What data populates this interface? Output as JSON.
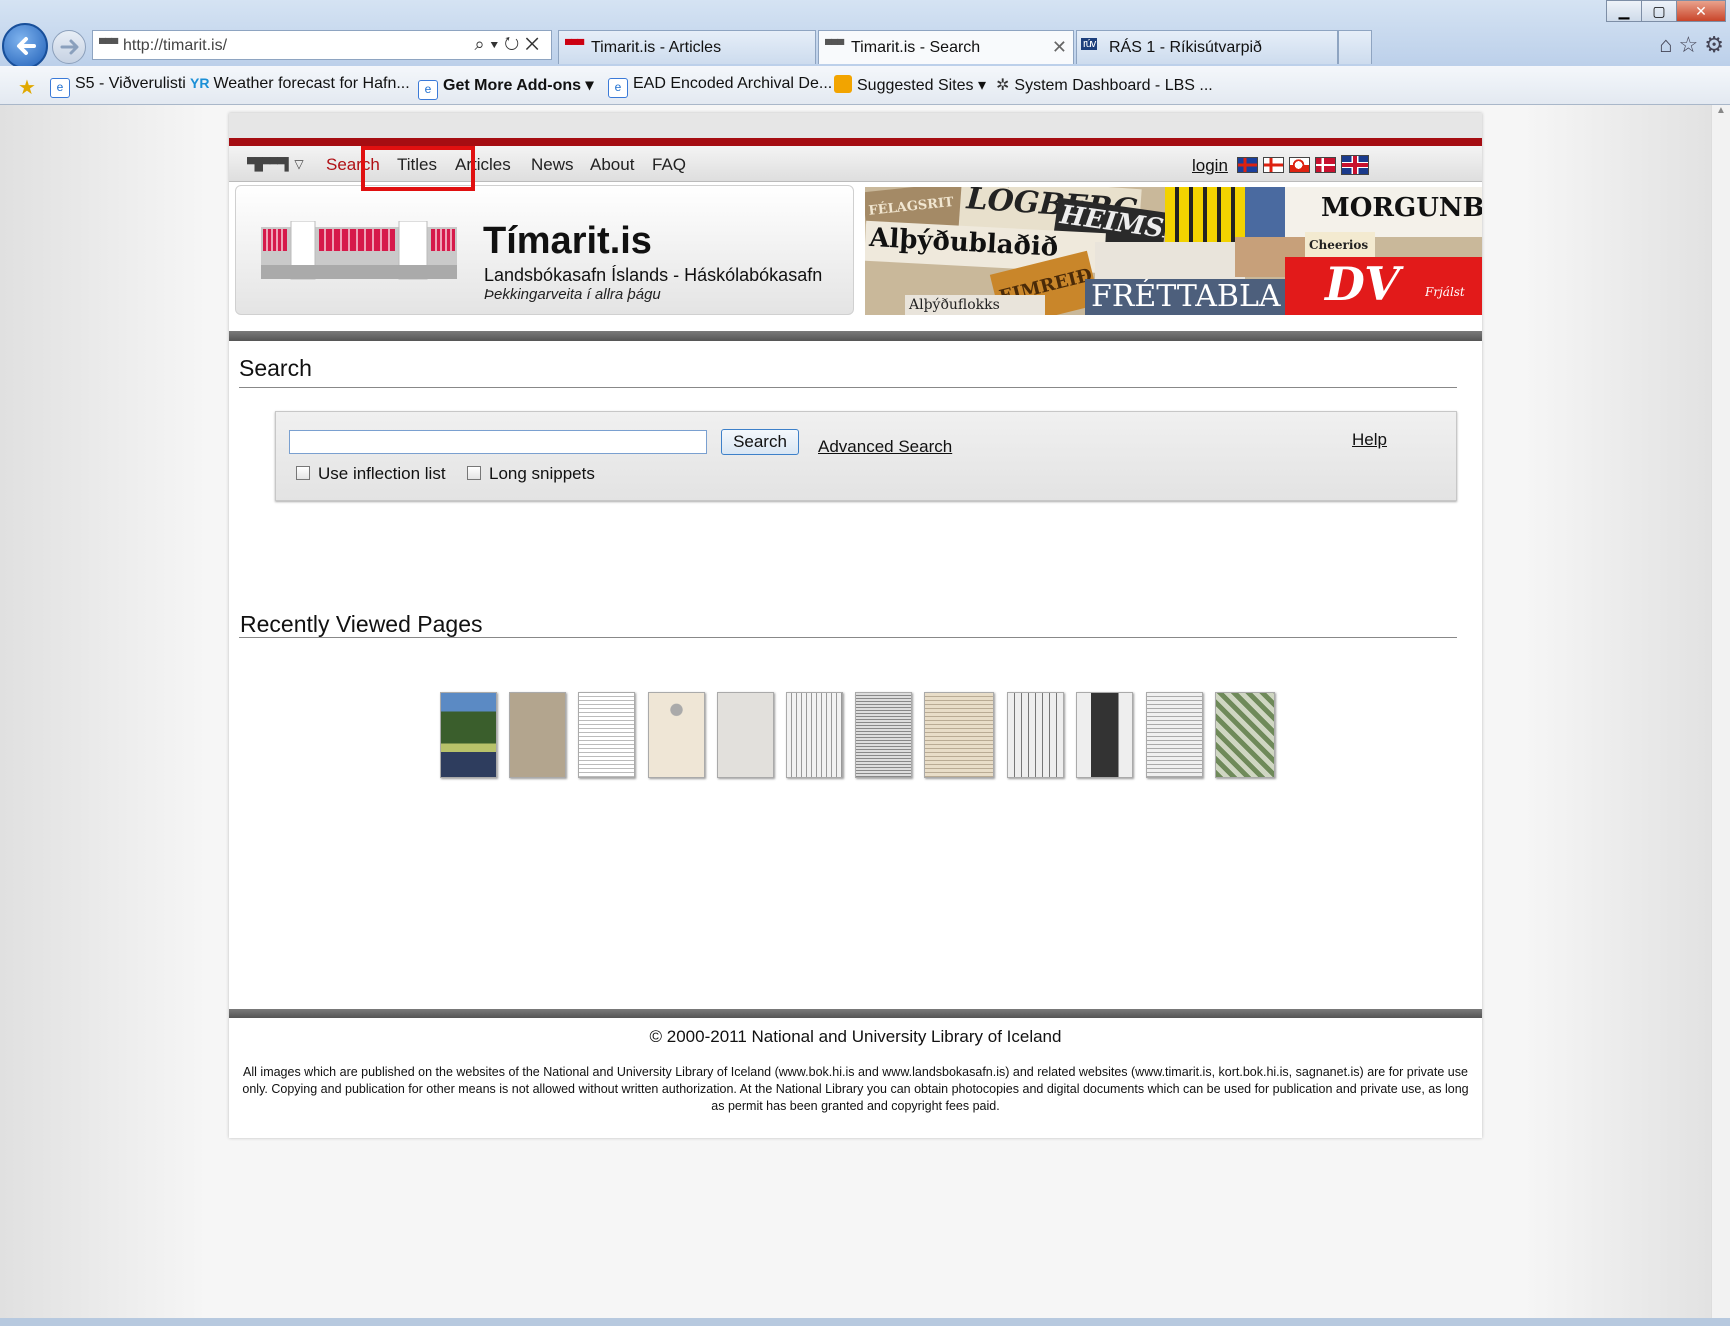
{
  "browser": {
    "address_url": "http://timarit.is/",
    "tabs": [
      {
        "label": "Timarit.is - Articles"
      },
      {
        "label": "Timarit.is - Search"
      },
      {
        "label": "RÁS 1 - Ríkisútvarpið"
      }
    ],
    "favorites": [
      {
        "label": "S5 - Viðverulisti",
        "icon": "ie-page-icon"
      },
      {
        "label": "Weather forecast for Hafn...",
        "icon": "yr-icon"
      },
      {
        "label": "Get More Add-ons",
        "icon": "ie-page-icon"
      },
      {
        "label": "EAD Encoded Archival De...",
        "icon": "ie-page-icon"
      },
      {
        "label": "Suggested Sites",
        "icon": "suggested-sites-icon"
      },
      {
        "label": "System Dashboard - LBS ...",
        "icon": "dashboard-icon"
      }
    ]
  },
  "site": {
    "nav": [
      {
        "label": "Search",
        "current": true
      },
      {
        "label": "Titles"
      },
      {
        "label": "Articles"
      },
      {
        "label": "News"
      },
      {
        "label": "About"
      },
      {
        "label": "FAQ"
      }
    ],
    "login_label": "login",
    "languages": [
      "Icelandic",
      "Faroese",
      "Greenlandic",
      "Danish",
      "English"
    ],
    "title": "Tímarit.is",
    "subtitle": "Landsbókasafn Íslands - Háskólabókasafn",
    "motto": "Þekkingarveita í allra þágu",
    "collage_titles": [
      "FÉLAGSRIT",
      "LÖGBERG",
      "HEIMSK",
      "MORGUNBLA",
      "Alþýðublaðið",
      "EIMREIÐ",
      "FRÉTTABLA",
      "DV",
      "Alþýðuflokks",
      "Cheerios",
      "Frjálst"
    ],
    "accent_color": "#a50d12"
  },
  "search": {
    "heading": "Search",
    "input_value": "",
    "button_label": "Search",
    "advanced_label": "Advanced Search",
    "help_label": "Help",
    "options": [
      {
        "label": "Use inflection list",
        "checked": false
      },
      {
        "label": "Long snippets",
        "checked": false
      }
    ]
  },
  "recent": {
    "heading": "Recently Viewed Pages",
    "thumbnails": 12
  },
  "footer": {
    "copyright": "© 2000-2011 National and University Library of Iceland",
    "disclaimer": "All images which are published on the websites of the National and University Library of Iceland (www.bok.hi.is and www.landsbokasafn.is) and related websites (www.timarit.is, kort.bok.hi.is, sagnanet.is) are for private use only. Copying and publication for other means is not allowed without written authorization. At the National Library you can obtain photocopies and digital documents which can be used for publication and private use, as long as permit has been granted and copyright fees paid."
  }
}
